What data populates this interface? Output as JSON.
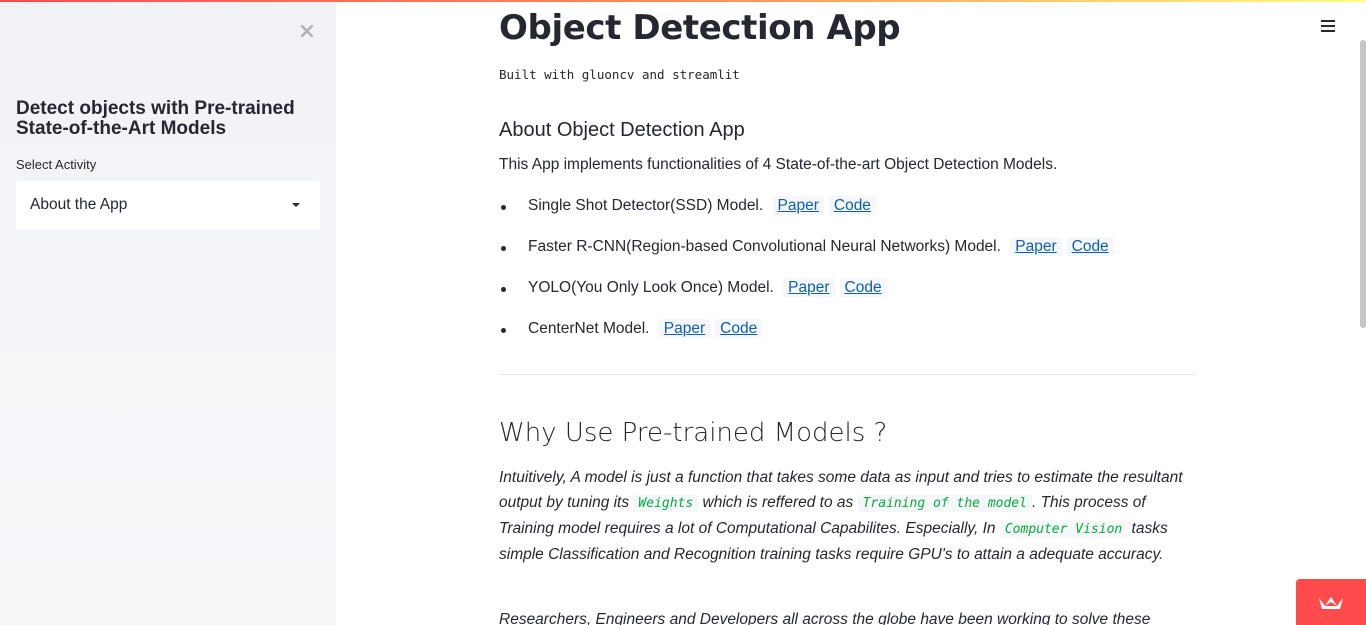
{
  "sidebar": {
    "close_icon": "close-icon",
    "title": "Detect objects with Pre-trained State-of-the-Art Models",
    "select_label": "Select Activity",
    "select_value": "About the App"
  },
  "main": {
    "title": "Object Detection App",
    "subtitle": "Built with gluoncv and streamlit",
    "about_heading": "About Object Detection App",
    "intro": "This App implements functionalities of 4 State-of-the-art Object Detection Models.",
    "models": [
      {
        "label": "Single Shot Detector(SSD) Model.",
        "paper": "Paper",
        "code": "Code"
      },
      {
        "label": "Faster R-CNN(Region-based Convolutional Neural Networks) Model.",
        "paper": "Paper",
        "code": "Code"
      },
      {
        "label": "YOLO(You Only Look Once) Model.",
        "paper": "Paper",
        "code": "Code"
      },
      {
        "label": "CenterNet Model.",
        "paper": "Paper",
        "code": "Code"
      }
    ],
    "why_heading": "Why Use Pre-trained Models ?",
    "para1": {
      "t1": "Intuitively, A model is just a function that takes some data as input and tries to estimate the resultant output by tuning its ",
      "c1": "Weights",
      "t2": " which is reffered to as ",
      "c2": "Training of the model",
      "t3": ". This process of Training model requires a lot of Computational Capabilites. Especially, In ",
      "c3": "Computer Vision",
      "t4": " tasks simple Classification and Recognition training tasks require GPU's to attain a adequate accuracy."
    },
    "para2": "Researchers, Engineers and Developers all across the globe have been working to solve these"
  },
  "colors": {
    "accent": "#ff4b4b",
    "link": "#0e5fb0",
    "code": "#09ab3b",
    "sidebar_bg": "#f0f2f6"
  },
  "icons": {
    "menu": "hamburger-menu-icon",
    "badge": "streamlit-crown-icon"
  }
}
